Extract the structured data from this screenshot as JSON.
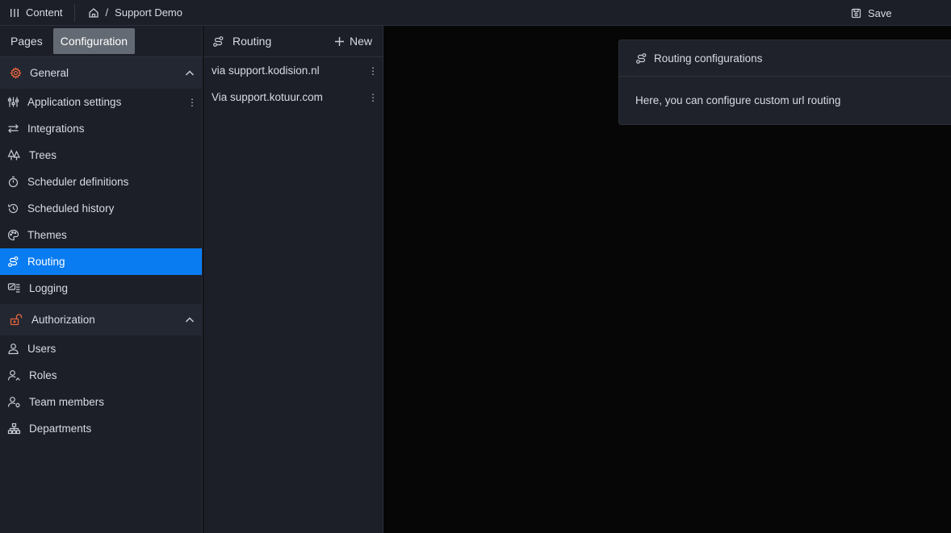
{
  "topbar": {
    "content_label": "Content",
    "breadcrumb_sep": "/",
    "breadcrumb_page": "Support Demo",
    "save_label": "Save"
  },
  "sidebar": {
    "tabs": [
      {
        "label": "Pages",
        "active": false
      },
      {
        "label": "Configuration",
        "active": true
      }
    ],
    "sections": [
      {
        "title": "General",
        "items": [
          {
            "label": "Application settings",
            "icon": "sliders-icon"
          },
          {
            "label": "Integrations",
            "icon": "arrows-icon"
          },
          {
            "label": "Trees",
            "icon": "trees-icon"
          },
          {
            "label": "Scheduler definitions",
            "icon": "timer-icon"
          },
          {
            "label": "Scheduled history",
            "icon": "history-icon"
          },
          {
            "label": "Themes",
            "icon": "palette-icon"
          },
          {
            "label": "Routing",
            "icon": "route-icon",
            "active": true
          },
          {
            "label": "Logging",
            "icon": "logging-icon"
          }
        ]
      },
      {
        "title": "Authorization",
        "items": [
          {
            "label": "Users",
            "icon": "user-icon"
          },
          {
            "label": "Roles",
            "icon": "roles-icon"
          },
          {
            "label": "Team members",
            "icon": "team-icon"
          },
          {
            "label": "Departments",
            "icon": "departments-icon"
          }
        ]
      }
    ]
  },
  "midpanel": {
    "title": "Routing",
    "new_label": "New",
    "items": [
      {
        "label": "via support.kodision.nl"
      },
      {
        "label": "Via support.kotuur.com"
      }
    ]
  },
  "card": {
    "title": "Routing configurations",
    "body": "Here, you can configure custom url routing"
  },
  "colors": {
    "accent": "#0a7cf2",
    "general_icon": "#e8643c",
    "authorization_icon": "#e8643c",
    "panel_bg": "#1c1f27",
    "main_bg": "#060606"
  }
}
